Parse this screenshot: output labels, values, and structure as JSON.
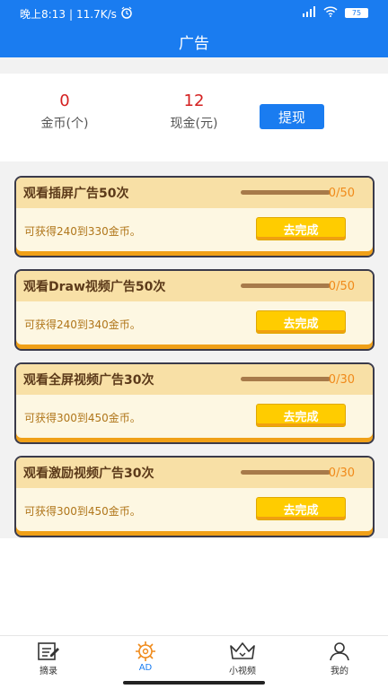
{
  "status": {
    "time": "晚上8:13",
    "speed": "11.7K/s",
    "battery": "75"
  },
  "nav": {
    "title": "广告"
  },
  "summary": {
    "coins_value": "0",
    "coins_label": "金币(个)",
    "cash_value": "12",
    "cash_label": "现金(元)",
    "withdraw_label": "提现"
  },
  "tasks": [
    {
      "name": "观看插屏广告50次",
      "progress": "0/50",
      "reward": "可获得240到330金币。",
      "button": "去完成"
    },
    {
      "name": "观看Draw视频广告50次",
      "progress": "0/50",
      "reward": "可获得240到340金币。",
      "button": "去完成"
    },
    {
      "name": "观看全屏视频广告30次",
      "progress": "0/30",
      "reward": "可获得300到450金币。",
      "button": "去完成"
    },
    {
      "name": "观看激励视频广告30次",
      "progress": "0/30",
      "reward": "可获得300到450金币。",
      "button": "去完成"
    }
  ],
  "tabs": [
    {
      "label": "摘录",
      "icon": "edit-icon"
    },
    {
      "label": "AD",
      "icon": "gear-icon"
    },
    {
      "label": "小视频",
      "icon": "crown-icon"
    },
    {
      "label": "我的",
      "icon": "user-icon"
    }
  ],
  "colors": {
    "accent": "#1a7cf0",
    "number_red": "#d42020",
    "button_yellow": "#ffcc00"
  }
}
